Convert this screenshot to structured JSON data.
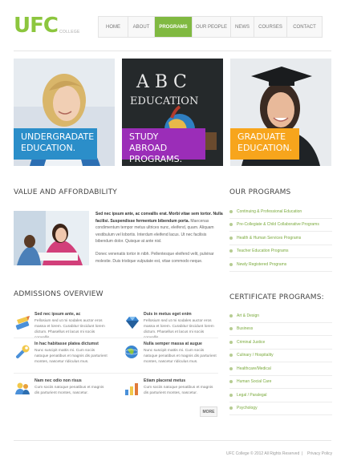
{
  "logo": {
    "main": "UFC",
    "sub": "COLLEGE"
  },
  "nav": {
    "items": [
      {
        "label": "HOME"
      },
      {
        "label": "ABOUT"
      },
      {
        "label": "PROGRAMS"
      },
      {
        "label": "OUR PEOPLE"
      },
      {
        "label": "NEWS"
      },
      {
        "label": "COURSES"
      },
      {
        "label": "CONTACT"
      }
    ],
    "active_index": 2
  },
  "banners": [
    {
      "line1": "UNDERGRADATE",
      "line2": "EDUCATION.",
      "color": "#2b8ec9"
    },
    {
      "line1": "STUDY ABROAD",
      "line2": "PROGRAMS.",
      "color": "#9b2db8"
    },
    {
      "line1": "GRADUATE",
      "line2": "EDUCATION.",
      "color": "#f7a51c"
    }
  ],
  "chalkboard": {
    "letters": "A B C",
    "word": "EDUCATION"
  },
  "value": {
    "title": "VALUE AND AFFORDABILITY",
    "p1_lead": "Sed nec ipsum ante, ac convallis erat. Morbi vitae sem tortor. Nulla facilisi. Suspendisse fermentum bibendum porta.",
    "p1_rest": " Maecenas condimentum tempor metus ultrices nunc, eleifend, quam. Aliquam vestibulum vel lobortis. Interdum eleifend lacus. Ut nec facilisis bibendum dolor. Quisque at ante nisl.",
    "p2": "Donec venenatis tortor in nibh. Pellentesque eleifend velit, pulvinar molestie. Duis tristique vulputate est, vitae commodo neque."
  },
  "programs": {
    "title": "OUR PROGRAMS",
    "items": [
      "Continuing & Professional Education",
      "Pre-Collegiate & Child Collaborative Programs",
      "Health & Human Services Programs",
      "Teacher Education Programs",
      "Newly Registered Programs"
    ]
  },
  "certificate": {
    "title": "CERTIFICATE PROGRAMS:",
    "items": [
      "Art & Design",
      "Business",
      "Criminal Justice",
      "Culinary / Hospitality",
      "Healthcare/Medical",
      "Human Social Care",
      "Legal / Paralegal",
      "Psychology"
    ]
  },
  "admissions": {
    "title": "ADMISSIONS OVERVIEW",
    "items": [
      {
        "title": "Sed nec ipsum ante, ac",
        "text": "Fellosium sed ut mi sodales auctor eros massa et lorem. Curabitur tincidunt lorem dictum. Phasellus et lacus mi sociis convallis."
      },
      {
        "title": "Duis in metus eget enim",
        "text": "Fellosium sed ut mi sodales auctor eros massa et lorem. Curabitur tincidunt lorem dictum. Phasellus et lacus mi sociis convallis."
      },
      {
        "title": "In hac habitasse platea dictumst",
        "text": "Nunc suscipit mattis mi. Cum sociis natoque penatibus et magnis dis parturient montes, nascetur ridiculus mus."
      },
      {
        "title": "Nulla semper massa at augue",
        "text": "Nunc suscipit mattis mi. Cum sociis natoque penatibus et magnis dis parturient montes, nascetur ridiculus mus."
      },
      {
        "title": "Nam nec odio non risus",
        "text": "Cum sociis natoque penatibus et magnis dis parturient montes, nascetur."
      },
      {
        "title": "Etiam placerat metus",
        "text": "Cum sociis natoque penatibus et magnis dis parturient montes, nascetur."
      }
    ],
    "more_label": "MORE"
  },
  "footer": {
    "copyright": "UFC College © 2012 All Rights Reserved",
    "separator": "|",
    "privacy": "Privacy Policy"
  },
  "colors": {
    "accent": "#80b941",
    "link": "#7aaa3c"
  }
}
